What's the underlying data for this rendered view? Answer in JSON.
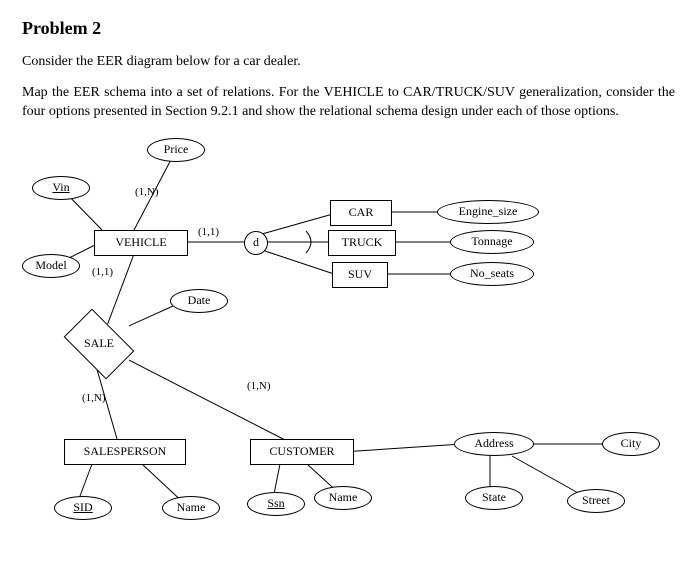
{
  "title": "Problem 2",
  "intro": "Consider the EER diagram below for a car dealer.",
  "task": "Map the EER schema into a set of relations.  For the VEHICLE to CAR/TRUCK/SUV generalization, consider the four options presented in Section 9.2.1 and show the relational schema design under each of those options.",
  "entities": {
    "vehicle": "VEHICLE",
    "car": "CAR",
    "truck": "TRUCK",
    "suv": "SUV",
    "salesperson": "SALESPERSON",
    "customer": "CUSTOMER"
  },
  "relationships": {
    "sale": "SALE"
  },
  "specialization": {
    "constraint": "d"
  },
  "attributes": {
    "price": "Price",
    "vin": "Vin",
    "model": "Model",
    "date": "Date",
    "engine_size": "Engine_size",
    "tonnage": "Tonnage",
    "no_seats": "No_seats",
    "sid": "SID",
    "sp_name": "Name",
    "ssn": "Ssn",
    "cust_name": "Name",
    "address": "Address",
    "city": "City",
    "state": "State",
    "street": "Street"
  },
  "cardinalities": {
    "vehicle_sale": "(1,1)",
    "price_vehicle": "(1,N)",
    "vehicle_spec": "(1,1)",
    "sale_customer": "(1,N)",
    "sale_salesperson": "(1,N)"
  },
  "chart_data": {
    "type": "EER",
    "entities": [
      {
        "name": "VEHICLE",
        "attributes": [
          {
            "name": "Vin",
            "key": true
          },
          {
            "name": "Model"
          },
          {
            "name": "Price",
            "card": "(1,N)"
          }
        ]
      },
      {
        "name": "CAR",
        "supertype": "VEHICLE",
        "attributes": [
          {
            "name": "Engine_size"
          }
        ]
      },
      {
        "name": "TRUCK",
        "supertype": "VEHICLE",
        "attributes": [
          {
            "name": "Tonnage"
          }
        ]
      },
      {
        "name": "SUV",
        "supertype": "VEHICLE",
        "attributes": [
          {
            "name": "No_seats"
          }
        ]
      },
      {
        "name": "SALESPERSON",
        "attributes": [
          {
            "name": "SID",
            "key": true
          },
          {
            "name": "Name"
          }
        ]
      },
      {
        "name": "CUSTOMER",
        "attributes": [
          {
            "name": "Ssn",
            "key": true
          },
          {
            "name": "Name"
          },
          {
            "name": "Address",
            "components": [
              "City",
              "State",
              "Street"
            ]
          }
        ]
      }
    ],
    "specialization": {
      "supertype": "VEHICLE",
      "constraint": "d",
      "subtypes": [
        "CAR",
        "TRUCK",
        "SUV"
      ],
      "card_to_supertype": "(1,1)"
    },
    "relationships": [
      {
        "name": "SALE",
        "participants": [
          {
            "entity": "VEHICLE",
            "card": "(1,1)"
          },
          {
            "entity": "SALESPERSON",
            "card": "(1,N)"
          },
          {
            "entity": "CUSTOMER",
            "card": "(1,N)"
          }
        ],
        "attributes": [
          {
            "name": "Date"
          }
        ]
      }
    ]
  }
}
